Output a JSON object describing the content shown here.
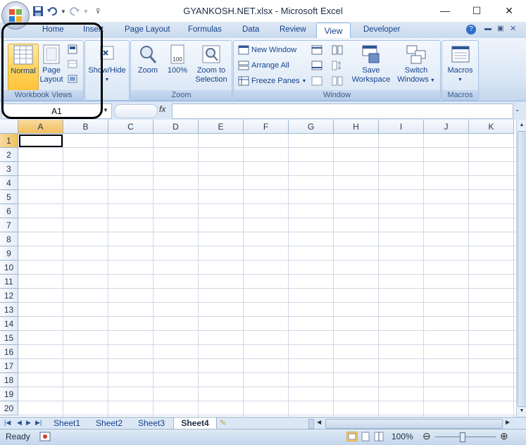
{
  "window": {
    "title": "GYANKOSH.NET.xlsx - Microsoft Excel",
    "minimize_glyph": "—",
    "maximize_glyph": "☐",
    "close_glyph": "✕"
  },
  "tabs": [
    "Home",
    "Insert",
    "Page Layout",
    "Formulas",
    "Data",
    "Review",
    "View",
    "Developer"
  ],
  "active_tab": "View",
  "ribbon": {
    "workbook_views": {
      "label": "Workbook Views",
      "normal": "Normal",
      "page_layout_line1": "Page",
      "page_layout_line2": "Layout"
    },
    "show_hide": {
      "label": "Show/Hide"
    },
    "zoom": {
      "label": "Zoom",
      "zoom_btn": "Zoom",
      "hundred": "100%",
      "hundred_icon_text": "100",
      "zoom_sel_line1": "Zoom to",
      "zoom_sel_line2": "Selection"
    },
    "window": {
      "label": "Window",
      "new_window": "New Window",
      "arrange_all": "Arrange All",
      "freeze_panes": "Freeze Panes",
      "save_ws_line1": "Save",
      "save_ws_line2": "Workspace",
      "switch_line1": "Switch",
      "switch_line2": "Windows"
    },
    "macros": {
      "label": "Macros",
      "btn": "Macros"
    }
  },
  "formula_bar": {
    "name_box": "A1",
    "fx": "fx",
    "formula": ""
  },
  "grid": {
    "columns": [
      "A",
      "B",
      "C",
      "D",
      "E",
      "F",
      "G",
      "H",
      "I",
      "J",
      "K"
    ],
    "rows": [
      "1",
      "2",
      "3",
      "4",
      "5",
      "6",
      "7",
      "8",
      "9",
      "10",
      "11",
      "12",
      "13",
      "14",
      "15",
      "16",
      "17",
      "18",
      "19",
      "20"
    ],
    "selected_cell": "A1"
  },
  "sheets": [
    "Sheet1",
    "Sheet2",
    "Sheet3",
    "Sheet4"
  ],
  "active_sheet": "Sheet4",
  "status": {
    "mode": "Ready",
    "zoom": "100%"
  },
  "colors": {
    "accent": "#15428b",
    "ribbon_bg": "#dbe7f5",
    "selected_header": "#f1c05c"
  }
}
